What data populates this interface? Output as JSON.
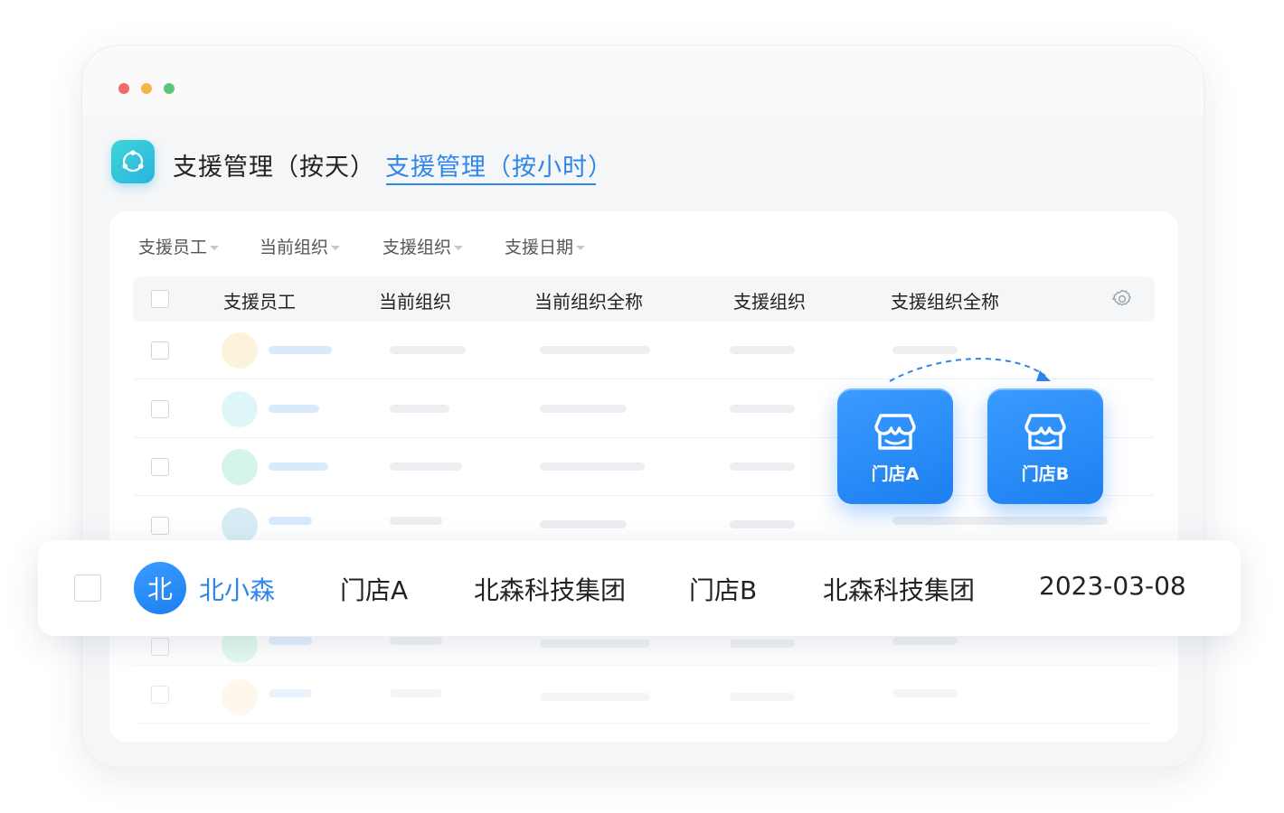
{
  "tabs": [
    {
      "label": "支援管理（按天）",
      "active": false
    },
    {
      "label": "支援管理（按小时）",
      "active": true
    }
  ],
  "filters": [
    "支援员工",
    "当前组织",
    "支援组织",
    "支援日期"
  ],
  "columns": [
    "支援员工",
    "当前组织",
    "当前组织全称",
    "支援组织",
    "支援组织全称"
  ],
  "stores": [
    {
      "label": "门店A"
    },
    {
      "label": "门店B"
    }
  ],
  "highlight_row": {
    "avatar": "北",
    "name": "北小森",
    "current_org": "门店A",
    "current_org_full": "北森科技集团",
    "support_org": "门店B",
    "support_org_full": "北森科技集团",
    "date": "2023-03-08"
  },
  "colors": {
    "accent": "#2f86e8",
    "avatar_placeholders": [
      "#fdf3dc",
      "#dff6f8",
      "#d5f5ea",
      "#d7edf6",
      "#d5f5ea",
      "#fdf3dc"
    ]
  },
  "icons": {
    "app": "app-logo-icon",
    "settings": "gear-icon",
    "store": "storefront-icon"
  }
}
